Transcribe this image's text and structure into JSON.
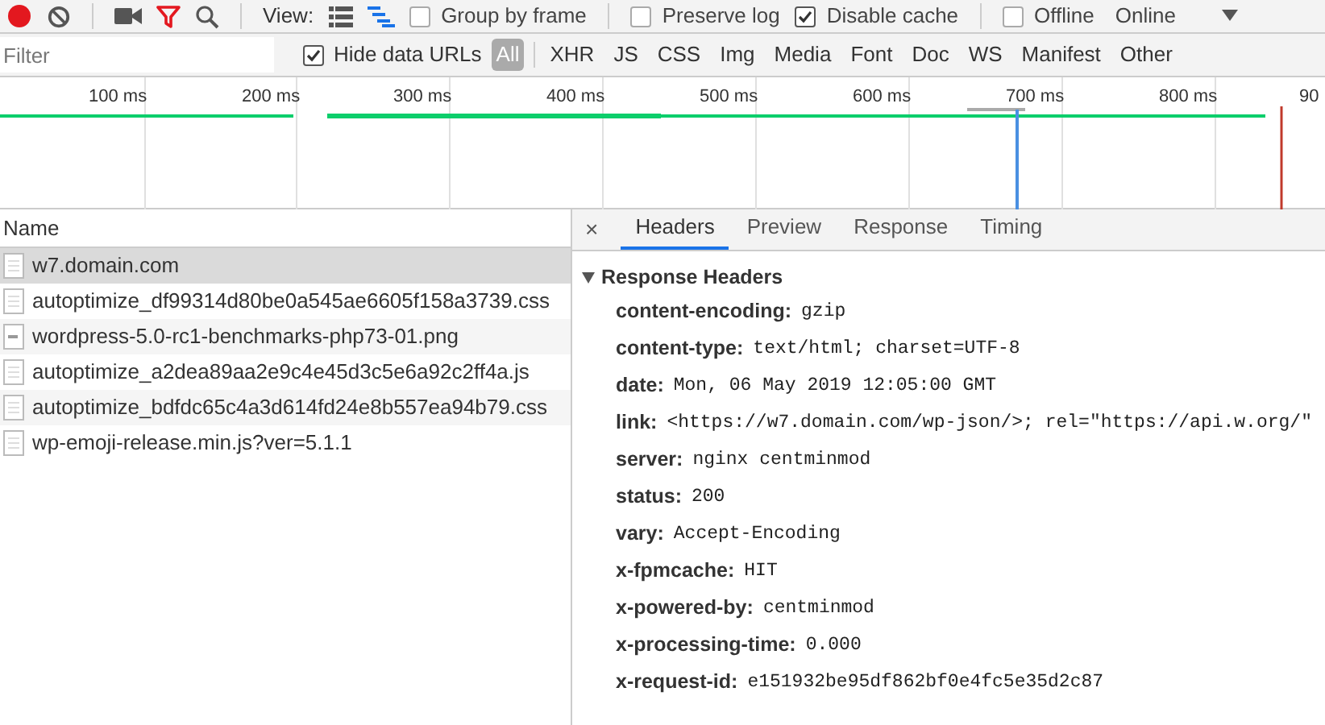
{
  "toolbar": {
    "view_label": "View:",
    "options": [
      {
        "label": "Group by frame",
        "checked": false
      },
      {
        "label": "Preserve log",
        "checked": false
      },
      {
        "label": "Disable cache",
        "checked": true
      },
      {
        "label": "Offline",
        "checked": false
      }
    ],
    "throttle": "Online",
    "recording": true
  },
  "filter_bar": {
    "placeholder": "Filter",
    "hide_data_urls": {
      "label": "Hide data URLs",
      "checked": true
    },
    "types": [
      {
        "label": "All",
        "selected": true
      },
      {
        "label": "XHR",
        "selected": false
      },
      {
        "label": "JS",
        "selected": false
      },
      {
        "label": "CSS",
        "selected": false
      },
      {
        "label": "Img",
        "selected": false
      },
      {
        "label": "Media",
        "selected": false
      },
      {
        "label": "Font",
        "selected": false
      },
      {
        "label": "Doc",
        "selected": false
      },
      {
        "label": "WS",
        "selected": false
      },
      {
        "label": "Manifest",
        "selected": false
      },
      {
        "label": "Other",
        "selected": false
      }
    ]
  },
  "timeline": {
    "ticks": [
      "100 ms",
      "200 ms",
      "300 ms",
      "400 ms",
      "500 ms",
      "600 ms",
      "700 ms",
      "800 ms",
      "90"
    ]
  },
  "requests": {
    "column": "Name",
    "rows": [
      {
        "name": "w7.domain.com",
        "kind": "document",
        "selected": true
      },
      {
        "name": "autoptimize_df99314d80be0a545ae6605f158a3739.css",
        "kind": "document",
        "selected": false
      },
      {
        "name": "wordpress-5.0-rc1-benchmarks-php73-01.png",
        "kind": "image",
        "selected": false
      },
      {
        "name": "autoptimize_a2dea89aa2e9c4e45d3c5e6a92c2ff4a.js",
        "kind": "document",
        "selected": false
      },
      {
        "name": "autoptimize_bdfdc65c4a3d614fd24e8b557ea94b79.css",
        "kind": "document",
        "selected": false
      },
      {
        "name": "wp-emoji-release.min.js?ver=5.1.1",
        "kind": "document",
        "selected": false
      }
    ]
  },
  "details": {
    "close": "×",
    "tabs": [
      {
        "label": "Headers",
        "selected": true
      },
      {
        "label": "Preview",
        "selected": false
      },
      {
        "label": "Response",
        "selected": false
      },
      {
        "label": "Timing",
        "selected": false
      }
    ],
    "section": {
      "title": "Response Headers",
      "expanded": true,
      "headers": [
        {
          "name": "content-encoding:",
          "value": "gzip"
        },
        {
          "name": "content-type:",
          "value": "text/html; charset=UTF-8"
        },
        {
          "name": "date:",
          "value": "Mon, 06 May 2019 12:05:00 GMT"
        },
        {
          "name": "link:",
          "value": "<https://w7.domain.com/wp-json/>; rel=\"https://api.w.org/\""
        },
        {
          "name": "server:",
          "value": "nginx centminmod"
        },
        {
          "name": "status:",
          "value": "200"
        },
        {
          "name": "vary:",
          "value": "Accept-Encoding"
        },
        {
          "name": "x-fpmcache:",
          "value": "HIT"
        },
        {
          "name": "x-powered-by:",
          "value": "centminmod"
        },
        {
          "name": "x-processing-time:",
          "value": "0.000"
        },
        {
          "name": "x-request-id:",
          "value": "e151932be95df862bf0e4fc5e35d2c87"
        }
      ]
    }
  }
}
